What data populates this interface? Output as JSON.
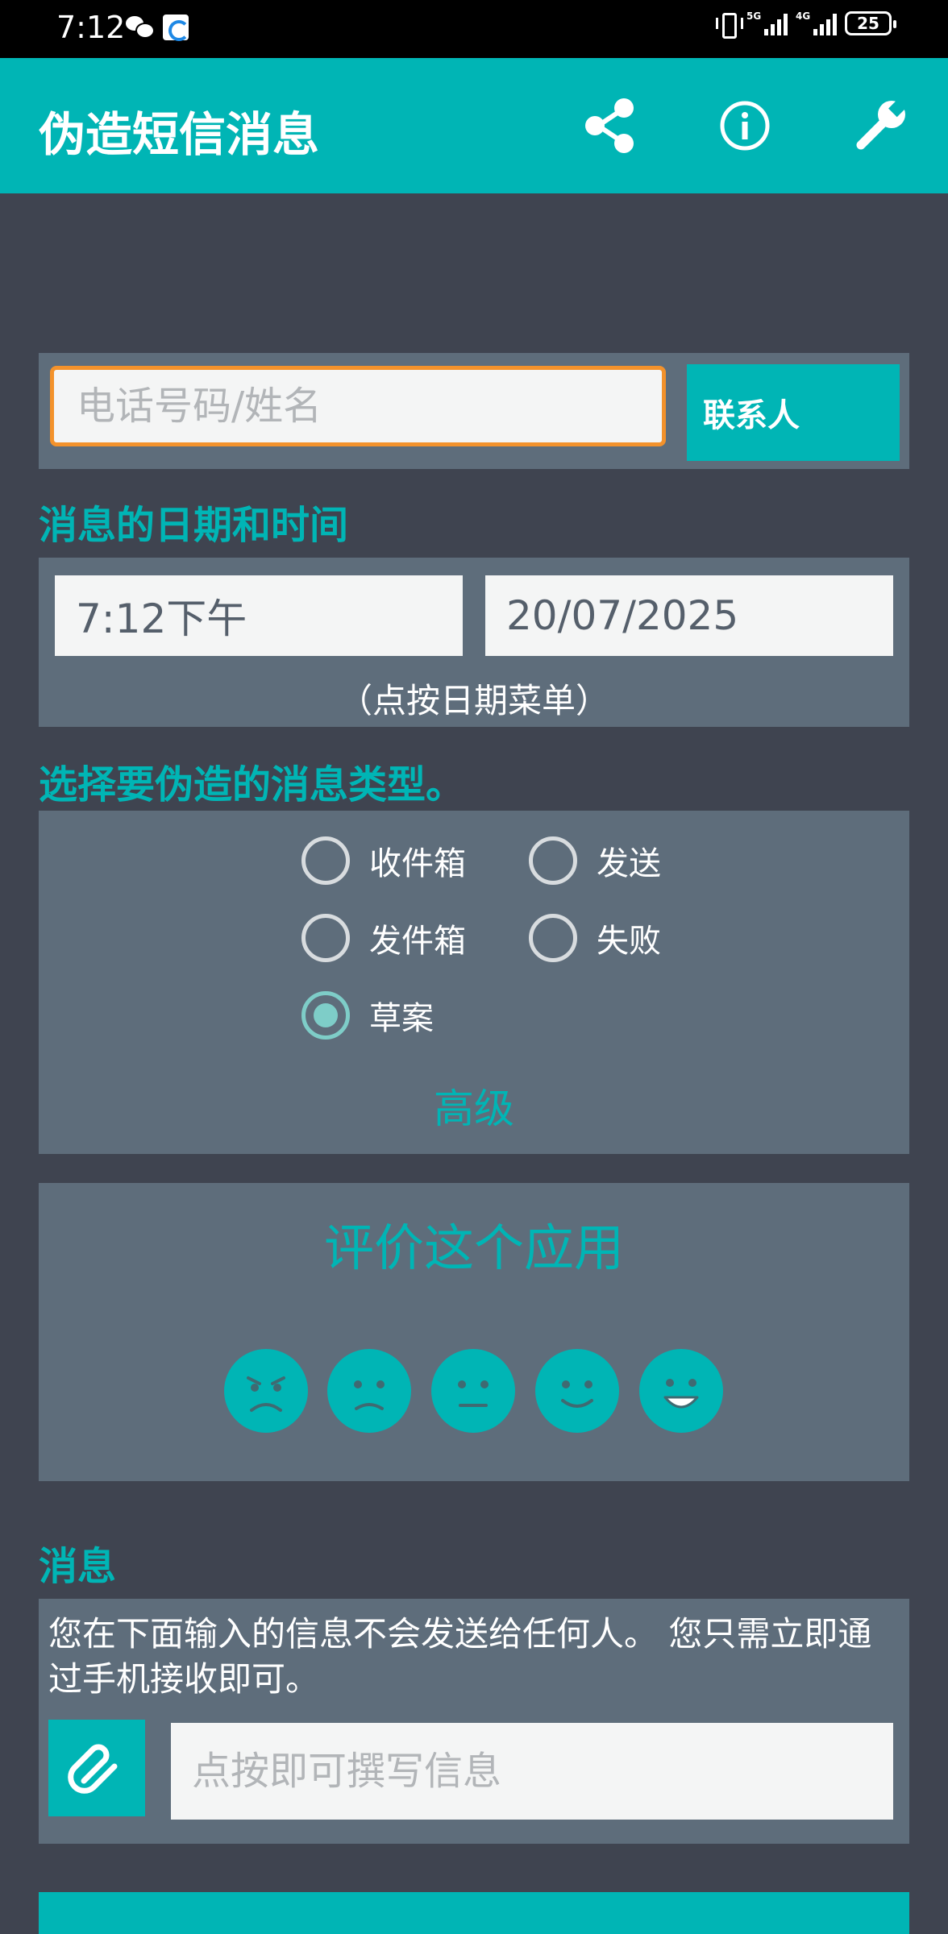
{
  "status_bar": {
    "time": "7:12",
    "signal1_tag": "5G",
    "signal2_tag": "4G",
    "battery": "25"
  },
  "app_bar": {
    "title": "伪造短信消息",
    "actions": [
      "share-icon",
      "info-icon",
      "wrench-icon"
    ]
  },
  "recipient": {
    "placeholder": "电话号码/姓名",
    "contacts_label": "联系人"
  },
  "datetime": {
    "section_label": "消息的日期和时间",
    "time_value": "7:12下午",
    "date_value": "20/07/2025",
    "hint": "（点按日期菜单）"
  },
  "message_type": {
    "section_label": "选择要伪造的消息类型。",
    "options": [
      {
        "label": "收件箱",
        "checked": false
      },
      {
        "label": "发送",
        "checked": false
      },
      {
        "label": "发件箱",
        "checked": false
      },
      {
        "label": "失败",
        "checked": false
      },
      {
        "label": "草案",
        "checked": true
      }
    ],
    "advanced_label": "高级"
  },
  "rating": {
    "title": "评价这个应用",
    "faces": [
      "angry-face-icon",
      "sad-face-icon",
      "neutral-face-icon",
      "smile-face-icon",
      "happy-face-icon"
    ]
  },
  "message": {
    "section_label": "消息",
    "note": "您在下面输入的信息不会发送给任何人。 您只需立即通过手机接收即可。",
    "placeholder": "点按即可撰写信息"
  },
  "colors": {
    "accent": "#00b5b5",
    "background": "#3f4450",
    "panel": "#5e6d7b",
    "focus": "#f3922b"
  }
}
